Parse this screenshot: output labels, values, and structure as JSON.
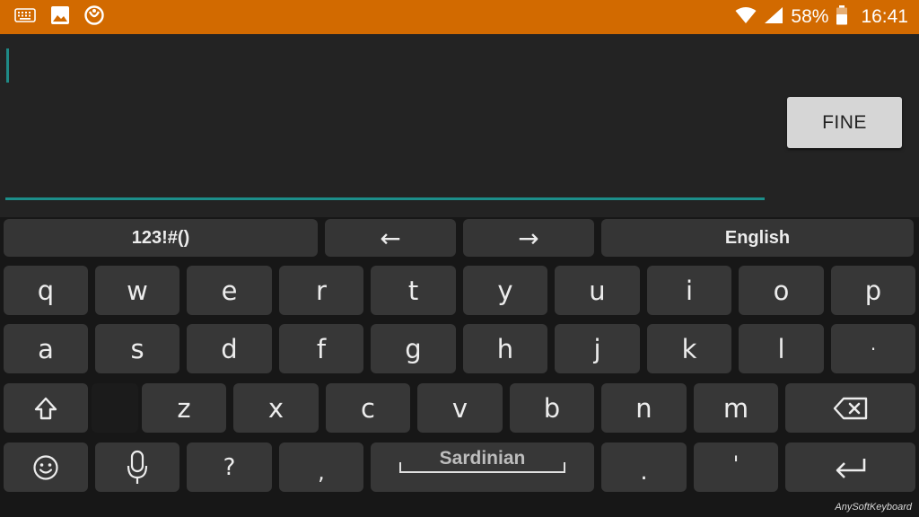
{
  "status_bar": {
    "battery": "58%",
    "time": "16:41",
    "left_icons": [
      "keyboard-icon",
      "image-icon",
      "app-notification-icon"
    ],
    "right_icons": [
      "wifi-icon",
      "signal-icon",
      "battery-icon"
    ],
    "color": "#d26a00"
  },
  "editor": {
    "text_value": "",
    "action_button": "FINE",
    "accent_color": "#1c8e8a"
  },
  "keyboard": {
    "top_row": {
      "symbols": "123!#()",
      "left_arrow": "←",
      "right_arrow": "→",
      "language": "English"
    },
    "row1": [
      "q",
      "w",
      "e",
      "r",
      "t",
      "y",
      "u",
      "i",
      "o",
      "p"
    ],
    "row2": [
      "a",
      "s",
      "d",
      "f",
      "g",
      "h",
      "j",
      "k",
      "l",
      "·"
    ],
    "row3": [
      "z",
      "x",
      "c",
      "v",
      "b",
      "n",
      "m"
    ],
    "bottom": {
      "question": "?",
      "comma": ",",
      "space_label": "Sardinian",
      "period": ".",
      "apostrophe": "'"
    },
    "brand": "AnySoftKeyboard"
  }
}
